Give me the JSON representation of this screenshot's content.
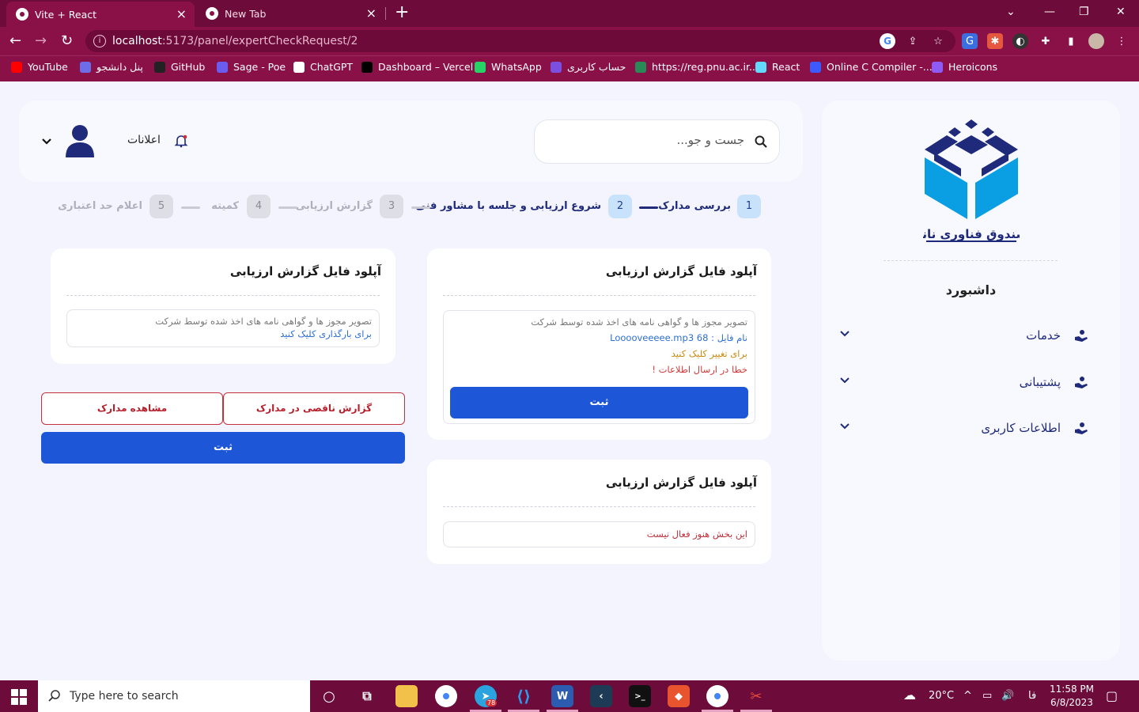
{
  "browser": {
    "tabs": [
      {
        "title": "Vite + React",
        "active": true
      },
      {
        "title": "New Tab",
        "active": false
      }
    ],
    "url_host": "localhost",
    "url_rest": ":5173/panel/expertCheckRequest/2",
    "bookmarks": [
      {
        "label": "YouTube",
        "color": "#ff0000"
      },
      {
        "label": "پنل دانشجو",
        "color": "#6d6de8"
      },
      {
        "label": "GitHub",
        "color": "#222222"
      },
      {
        "label": "Sage - Poe",
        "color": "#6b5cf0"
      },
      {
        "label": "ChatGPT",
        "color": "#ffffff"
      },
      {
        "label": "Dashboard – Vercel",
        "color": "#000000"
      },
      {
        "label": "WhatsApp",
        "color": "#25d366"
      },
      {
        "label": "حساب کاربری",
        "color": "#7b4fe0"
      },
      {
        "label": "https://reg.pnu.ac.ir...",
        "color": "#2a8a57"
      },
      {
        "label": "React",
        "color": "#61dafb"
      },
      {
        "label": "Online C Compiler -...",
        "color": "#3d5afe"
      },
      {
        "label": "Heroicons",
        "color": "#8e5cf5"
      }
    ]
  },
  "sidebar": {
    "title": "داشبورد",
    "logo_text": "صندوق فناوری نانو",
    "items": [
      {
        "label": "خدمات"
      },
      {
        "label": "پشتیبانی"
      },
      {
        "label": "اطلاعات کاربری"
      }
    ]
  },
  "header": {
    "search_placeholder": "جست و جو...",
    "notifications_label": "اعلانات"
  },
  "steps": [
    {
      "num": "1",
      "label": "بررسی مدارک",
      "state": "done"
    },
    {
      "num": "2",
      "label": "شروع ارزیابی و جلسه با مشاور فنی",
      "state": "current"
    },
    {
      "num": "3",
      "label": "گزارش ارزیابی",
      "state": "pending"
    },
    {
      "num": "4",
      "label": "کمیته",
      "state": "pending"
    },
    {
      "num": "5",
      "label": "اعلام حد اعتباری",
      "state": "pending"
    }
  ],
  "cards": {
    "main": {
      "title": "آپلود فایل گزارش ارزیابی",
      "hint": "تصویر مجوز ها و گواهی نامه های اخذ شده توسط شرکت",
      "file_prefix": "نام فایل : ",
      "file_name": "Looooveeeee.mp3 68",
      "change_text": "برای تغییر کلیک کنید",
      "error_text": "خطا در ارسال اطلاعات !",
      "submit_label": "ثبت"
    },
    "second": {
      "title": "آپلود فایل گزارش ارزیابی",
      "inactive_text": "این بخش هنوز فعال نیست"
    },
    "left": {
      "title": "آپلود فایل گزارش ارزیابی",
      "hint": "تصویر مجوز ها و گواهی نامه های اخذ شده توسط شرکت",
      "upload_text": "برای بارگذاری کلیک کنید"
    }
  },
  "actions": {
    "report_label": "گزارش ناقصی در مدارک",
    "view_label": "مشاهده مدارک",
    "submit_label": "ثبت"
  },
  "taskbar": {
    "search_placeholder": "Type here to search",
    "weather": "20°C",
    "lang": "فا",
    "time": "11:58 PM",
    "date": "6/8/2023",
    "telegram_badge": "78"
  },
  "colors": {
    "chrome": "#8a1048",
    "primary_button": "#1e56d8",
    "navy": "#1f2a7a",
    "danger": "#c5303e"
  }
}
